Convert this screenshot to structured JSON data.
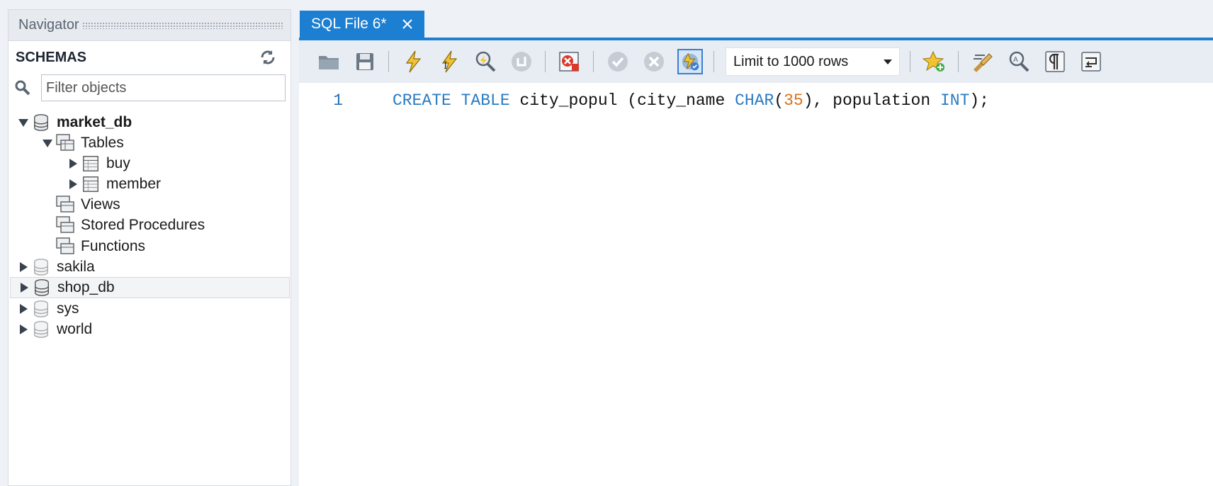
{
  "navigator": {
    "title": "Navigator",
    "schemas_label": "SCHEMAS",
    "filter_placeholder": "Filter objects"
  },
  "tree": {
    "market_db": "market_db",
    "tables": "Tables",
    "buy": "buy",
    "member": "member",
    "views": "Views",
    "stored_procedures": "Stored Procedures",
    "functions": "Functions",
    "sakila": "sakila",
    "shop_db": "shop_db",
    "sys": "sys",
    "world": "world"
  },
  "editor": {
    "tab_label": "SQL File 6*",
    "limit_select": "Limit to 1000 rows",
    "line_number": "1",
    "code": {
      "t1": "CREATE TABLE",
      "t2": " city_popul (city_name ",
      "t3": "CHAR",
      "t4": "(",
      "t5": "35",
      "t6": "), population ",
      "t7": "INT",
      "t8": ");"
    }
  },
  "colors": {
    "accent": "#1d7fd1",
    "keyword": "#2a7bc2",
    "number": "#d9721a"
  },
  "icons": [
    "refresh-icon",
    "search-icon",
    "database-icon",
    "table-folder-icon",
    "table-icon",
    "open-folder-icon",
    "save-icon",
    "execute-icon",
    "execute-cursor-icon",
    "explain-icon",
    "stop-icon",
    "error-toggle-icon",
    "commit-icon",
    "rollback-icon",
    "autocommit-icon",
    "bookmark-add-icon",
    "beautify-icon",
    "find-icon",
    "invisible-chars-icon",
    "wrap-icon",
    "close-icon"
  ]
}
